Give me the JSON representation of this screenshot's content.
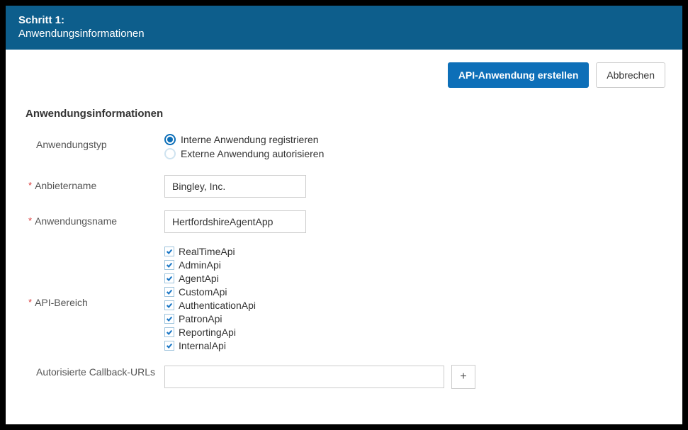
{
  "header": {
    "step": "Schritt 1:",
    "title": "Anwendungsinformationen"
  },
  "actions": {
    "create": "API-Anwendung erstellen",
    "cancel": "Abbrechen"
  },
  "section_title": "Anwendungsinformationen",
  "labels": {
    "app_type": "Anwendungstyp",
    "vendor_name": "Anbietername",
    "app_name": "Anwendungsname",
    "api_scope": "API-Bereich",
    "callback": "Autorisierte Callback-URLs"
  },
  "radios": {
    "internal": "Interne Anwendung registrieren",
    "external": "Externe Anwendung autorisieren"
  },
  "values": {
    "vendor": "Bingley, Inc.",
    "app": "HertfordshireAgentApp",
    "callback": ""
  },
  "scopes": [
    "RealTimeApi",
    "AdminApi",
    "AgentApi",
    "CustomApi",
    "AuthenticationApi",
    "PatronApi",
    "ReportingApi",
    "InternalApi"
  ],
  "add_symbol": "+"
}
